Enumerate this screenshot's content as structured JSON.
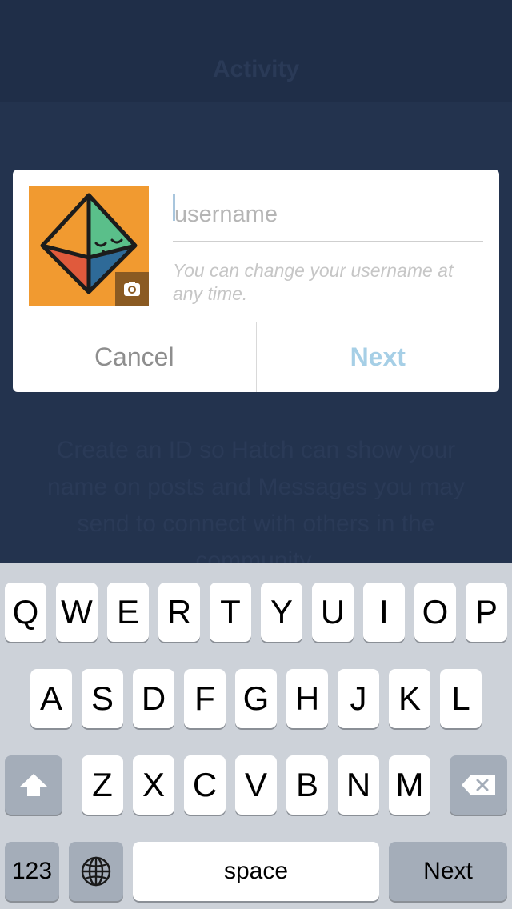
{
  "background": {
    "title": "Activity",
    "description": "Create an ID so Hatch can show your name on posts and Messages you may send to connect with others in the community."
  },
  "dialog": {
    "username_placeholder": "username",
    "username_value": "",
    "hint": "You can change your username at any time.",
    "cancel_label": "Cancel",
    "next_label": "Next"
  },
  "keyboard": {
    "row1": [
      "Q",
      "W",
      "E",
      "R",
      "T",
      "Y",
      "U",
      "I",
      "O",
      "P"
    ],
    "row2": [
      "A",
      "S",
      "D",
      "F",
      "G",
      "H",
      "J",
      "K",
      "L"
    ],
    "row3": [
      "Z",
      "X",
      "C",
      "V",
      "B",
      "N",
      "M"
    ],
    "numbers_label": "123",
    "space_label": "space",
    "return_label": "Next"
  },
  "colors": {
    "background": "#23334e",
    "avatar": "#f19a30",
    "accent_next": "#a6cfe6",
    "keyboard": "#cdd2d9"
  }
}
